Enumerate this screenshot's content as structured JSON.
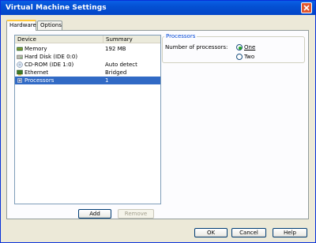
{
  "window": {
    "title": "Virtual Machine Settings"
  },
  "tabs": [
    {
      "label": "Hardware",
      "selected": true
    },
    {
      "label": "Options",
      "selected": false
    }
  ],
  "device_list": {
    "columns": [
      "Device",
      "Summary"
    ],
    "rows": [
      {
        "icon": "memory-icon",
        "device": "Memory",
        "summary": "192 MB",
        "selected": false
      },
      {
        "icon": "hard-disk-icon",
        "device": "Hard Disk (IDE 0:0)",
        "summary": "",
        "selected": false
      },
      {
        "icon": "cdrom-icon",
        "device": "CD-ROM (IDE 1:0)",
        "summary": "Auto detect",
        "selected": false
      },
      {
        "icon": "ethernet-icon",
        "device": "Ethernet",
        "summary": "Bridged",
        "selected": false
      },
      {
        "icon": "processor-icon",
        "device": "Processors",
        "summary": "1",
        "selected": true
      }
    ]
  },
  "list_buttons": {
    "add": "Add",
    "remove": "Remove"
  },
  "processors": {
    "group_title": "Processors",
    "label": "Number of processors:",
    "options": [
      {
        "label": "One",
        "selected": true
      },
      {
        "label": "Two",
        "selected": false
      }
    ]
  },
  "dialog_buttons": {
    "ok": "OK",
    "cancel": "Cancel",
    "help": "Help"
  },
  "colors": {
    "titlebar": "#0450D2",
    "selection": "#316AC5",
    "group_title": "#0046D5",
    "radio_dot": "#21A121",
    "close_button": "#E2572E"
  }
}
